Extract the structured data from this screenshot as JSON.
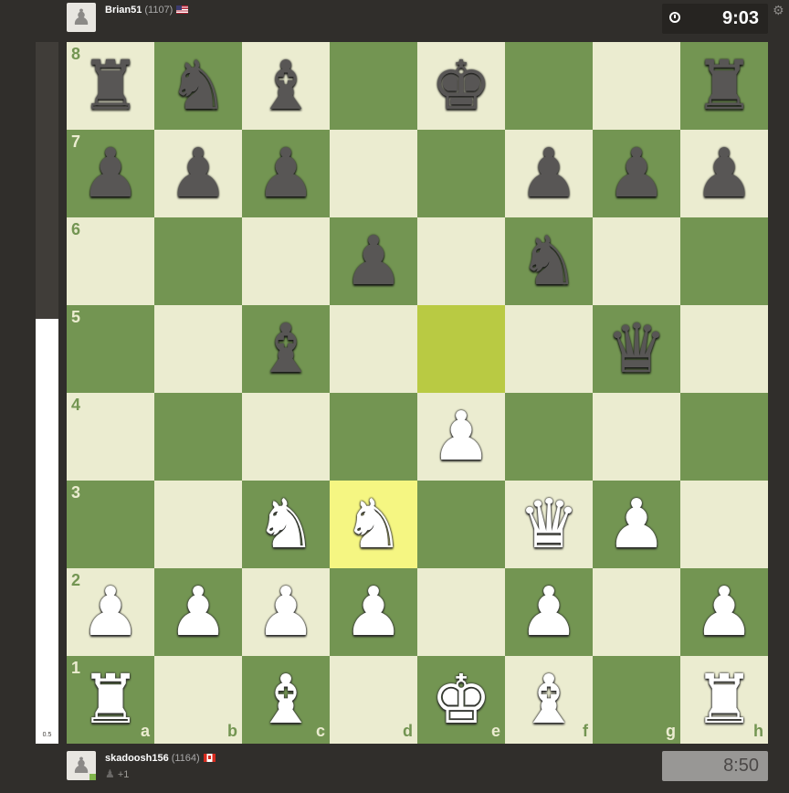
{
  "top_player": {
    "name": "Brian51",
    "rating": "(1107)",
    "flag": "us",
    "avatar_glyph": "♟"
  },
  "bottom_player": {
    "name": "skadoosh156",
    "rating": "(1164)",
    "flag": "ca",
    "avatar_glyph": "♟",
    "captured_glyph": "♟",
    "material": "+1"
  },
  "clocks": {
    "top": "9:03",
    "bottom": "8:50"
  },
  "eval": {
    "score": "0.5",
    "white_fraction": 0.605
  },
  "board": {
    "files": [
      "a",
      "b",
      "c",
      "d",
      "e",
      "f",
      "g",
      "h"
    ],
    "ranks": [
      "8",
      "7",
      "6",
      "5",
      "4",
      "3",
      "2",
      "1"
    ],
    "highlighted_squares": [
      "e5",
      "d3"
    ],
    "pieces": [
      {
        "square": "a8",
        "color": "b",
        "glyph": "♜",
        "name": "rook"
      },
      {
        "square": "b8",
        "color": "b",
        "glyph": "♞",
        "name": "knight"
      },
      {
        "square": "c8",
        "color": "b",
        "glyph": "♝",
        "name": "bishop"
      },
      {
        "square": "e8",
        "color": "b",
        "glyph": "♚",
        "name": "king"
      },
      {
        "square": "h8",
        "color": "b",
        "glyph": "♜",
        "name": "rook"
      },
      {
        "square": "a7",
        "color": "b",
        "glyph": "♟",
        "name": "pawn"
      },
      {
        "square": "b7",
        "color": "b",
        "glyph": "♟",
        "name": "pawn"
      },
      {
        "square": "c7",
        "color": "b",
        "glyph": "♟",
        "name": "pawn"
      },
      {
        "square": "f7",
        "color": "b",
        "glyph": "♟",
        "name": "pawn"
      },
      {
        "square": "g7",
        "color": "b",
        "glyph": "♟",
        "name": "pawn"
      },
      {
        "square": "h7",
        "color": "b",
        "glyph": "♟",
        "name": "pawn"
      },
      {
        "square": "d6",
        "color": "b",
        "glyph": "♟",
        "name": "pawn"
      },
      {
        "square": "f6",
        "color": "b",
        "glyph": "♞",
        "name": "knight"
      },
      {
        "square": "c5",
        "color": "b",
        "glyph": "♝",
        "name": "bishop"
      },
      {
        "square": "g5",
        "color": "b",
        "glyph": "♛",
        "name": "queen"
      },
      {
        "square": "e4",
        "color": "w",
        "glyph": "♟",
        "name": "pawn"
      },
      {
        "square": "c3",
        "color": "w",
        "glyph": "♞",
        "name": "knight"
      },
      {
        "square": "d3",
        "color": "w",
        "glyph": "♞",
        "name": "knight"
      },
      {
        "square": "f3",
        "color": "w",
        "glyph": "♛",
        "name": "queen"
      },
      {
        "square": "g3",
        "color": "w",
        "glyph": "♟",
        "name": "pawn"
      },
      {
        "square": "a2",
        "color": "w",
        "glyph": "♟",
        "name": "pawn"
      },
      {
        "square": "b2",
        "color": "w",
        "glyph": "♟",
        "name": "pawn"
      },
      {
        "square": "c2",
        "color": "w",
        "glyph": "♟",
        "name": "pawn"
      },
      {
        "square": "d2",
        "color": "w",
        "glyph": "♟",
        "name": "pawn"
      },
      {
        "square": "f2",
        "color": "w",
        "glyph": "♟",
        "name": "pawn"
      },
      {
        "square": "h2",
        "color": "w",
        "glyph": "♟",
        "name": "pawn"
      },
      {
        "square": "a1",
        "color": "w",
        "glyph": "♜",
        "name": "rook"
      },
      {
        "square": "c1",
        "color": "w",
        "glyph": "♝",
        "name": "bishop"
      },
      {
        "square": "e1",
        "color": "w",
        "glyph": "♚",
        "name": "king"
      },
      {
        "square": "f1",
        "color": "w",
        "glyph": "♝",
        "name": "bishop"
      },
      {
        "square": "h1",
        "color": "w",
        "glyph": "♜",
        "name": "rook"
      }
    ]
  },
  "colors": {
    "light_square": "#ebecd0",
    "dark_square": "#739552",
    "highlight_light": "#f5f682",
    "highlight_dark": "#b9ca43",
    "background": "#302e2b"
  },
  "icons": {
    "clock": "clock-icon",
    "settings": "gear-icon"
  }
}
